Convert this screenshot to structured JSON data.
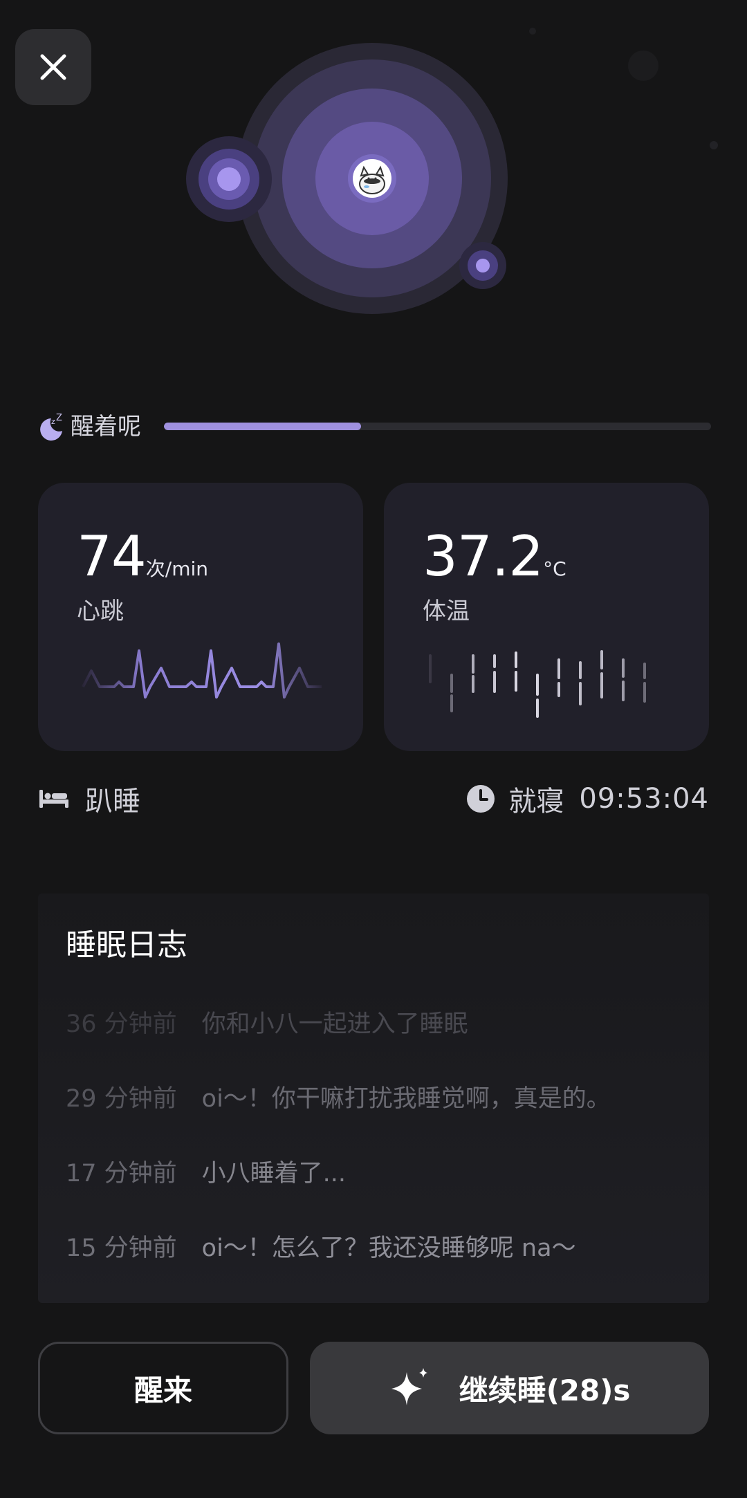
{
  "status": {
    "label": "醒着呢",
    "progress": 0.36
  },
  "heart_rate": {
    "value": "74",
    "unit": "次/min",
    "label": "心跳"
  },
  "temperature": {
    "value": "37.2",
    "unit": "°C",
    "label": "体温"
  },
  "posture": {
    "label": "趴睡",
    "icon": "bed-icon"
  },
  "bedtime": {
    "label": "就寝",
    "time": "09:53:04",
    "icon": "clock-icon"
  },
  "sleep_log": {
    "title": "睡眠日志",
    "entries": [
      {
        "time": "36 分钟前",
        "text": "你和小八一起进入了睡眠"
      },
      {
        "time": "29 分钟前",
        "text": "oi～！你干嘛打扰我睡觉啊，真是的。"
      },
      {
        "time": "17 分钟前",
        "text": "小八睡着了..."
      },
      {
        "time": "15 分钟前",
        "text": "oi～！怎么了？我还没睡够呢 na～"
      }
    ]
  },
  "buttons": {
    "wake": "醒来",
    "continue": "继续睡(28)s"
  },
  "colors": {
    "accent": "#9f90df",
    "background": "#151516",
    "card": "#21202a"
  }
}
